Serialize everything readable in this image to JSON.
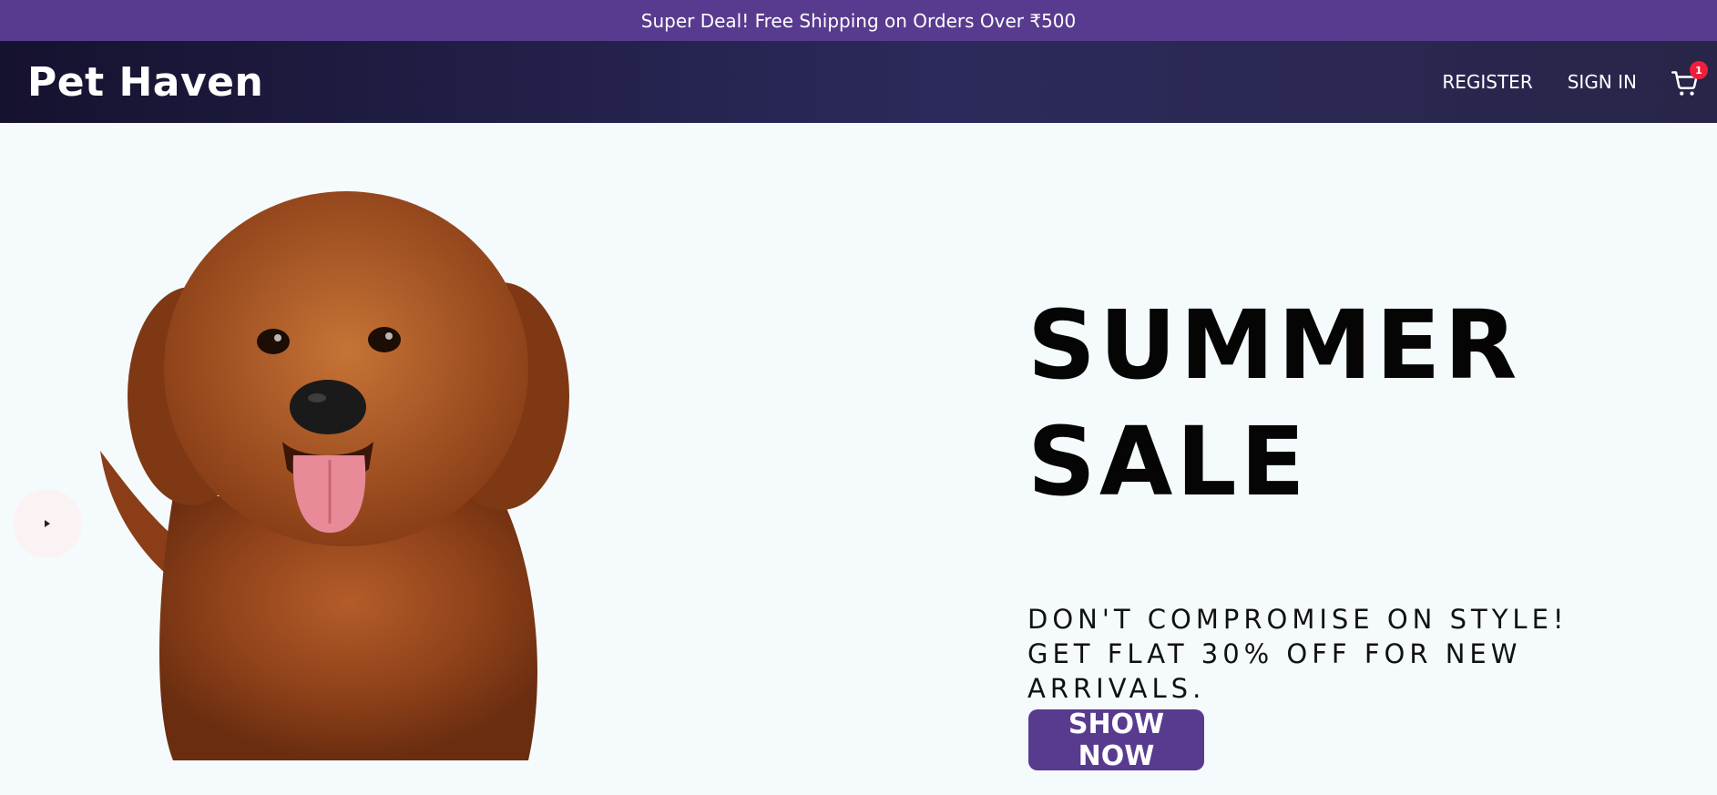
{
  "announcement": {
    "text": "Super Deal! Free Shipping on Orders Over ₹500"
  },
  "navbar": {
    "logo": "Pet Haven",
    "links": [
      {
        "label": "REGISTER"
      },
      {
        "label": "SIGN IN"
      }
    ],
    "cart": {
      "icon": "shopping-cart-icon",
      "badge_count": "1"
    }
  },
  "hero": {
    "slider_arrow_icon": "caret-right-icon",
    "image_subject": "dog-photo",
    "title": "SUMMER SALE",
    "description": "DON'T COMPROMISE ON STYLE! GET FLAT 30% OFF FOR NEW ARRIVALS.",
    "cta_label": "SHOW NOW"
  },
  "colors": {
    "announcement_bg": "#583b8f",
    "navbar_bg_start": "#15122f",
    "navbar_bg_end": "#282548",
    "hero_bg": "#f5fbfc",
    "cta_bg": "#583b8f",
    "badge_bg": "#ef1f3b"
  }
}
